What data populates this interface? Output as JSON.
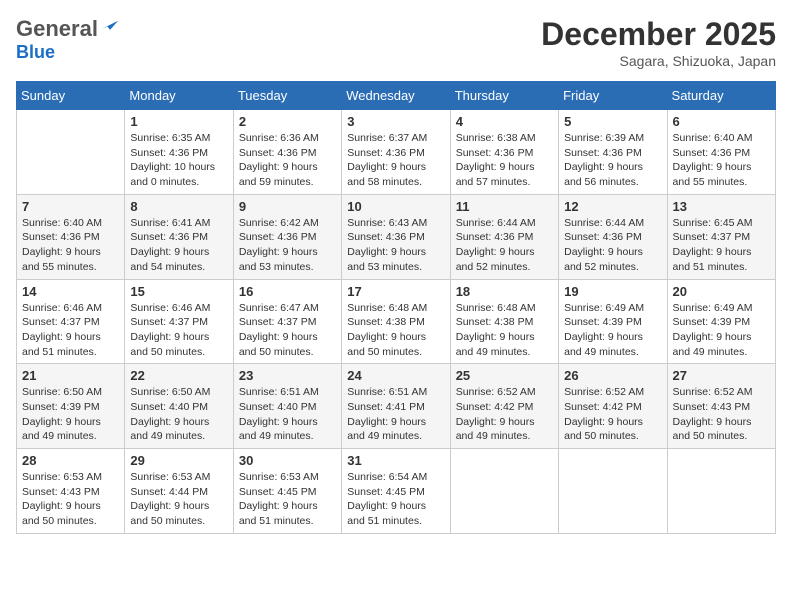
{
  "logo": {
    "general": "General",
    "blue": "Blue"
  },
  "header": {
    "month": "December 2025",
    "location": "Sagara, Shizuoka, Japan"
  },
  "weekdays": [
    "Sunday",
    "Monday",
    "Tuesday",
    "Wednesday",
    "Thursday",
    "Friday",
    "Saturday"
  ],
  "weeks": [
    [
      {
        "day": "",
        "sunrise": "",
        "sunset": "",
        "daylight": ""
      },
      {
        "day": "1",
        "sunrise": "Sunrise: 6:35 AM",
        "sunset": "Sunset: 4:36 PM",
        "daylight": "Daylight: 10 hours and 0 minutes."
      },
      {
        "day": "2",
        "sunrise": "Sunrise: 6:36 AM",
        "sunset": "Sunset: 4:36 PM",
        "daylight": "Daylight: 9 hours and 59 minutes."
      },
      {
        "day": "3",
        "sunrise": "Sunrise: 6:37 AM",
        "sunset": "Sunset: 4:36 PM",
        "daylight": "Daylight: 9 hours and 58 minutes."
      },
      {
        "day": "4",
        "sunrise": "Sunrise: 6:38 AM",
        "sunset": "Sunset: 4:36 PM",
        "daylight": "Daylight: 9 hours and 57 minutes."
      },
      {
        "day": "5",
        "sunrise": "Sunrise: 6:39 AM",
        "sunset": "Sunset: 4:36 PM",
        "daylight": "Daylight: 9 hours and 56 minutes."
      },
      {
        "day": "6",
        "sunrise": "Sunrise: 6:40 AM",
        "sunset": "Sunset: 4:36 PM",
        "daylight": "Daylight: 9 hours and 55 minutes."
      }
    ],
    [
      {
        "day": "7",
        "sunrise": "Sunrise: 6:40 AM",
        "sunset": "Sunset: 4:36 PM",
        "daylight": "Daylight: 9 hours and 55 minutes."
      },
      {
        "day": "8",
        "sunrise": "Sunrise: 6:41 AM",
        "sunset": "Sunset: 4:36 PM",
        "daylight": "Daylight: 9 hours and 54 minutes."
      },
      {
        "day": "9",
        "sunrise": "Sunrise: 6:42 AM",
        "sunset": "Sunset: 4:36 PM",
        "daylight": "Daylight: 9 hours and 53 minutes."
      },
      {
        "day": "10",
        "sunrise": "Sunrise: 6:43 AM",
        "sunset": "Sunset: 4:36 PM",
        "daylight": "Daylight: 9 hours and 53 minutes."
      },
      {
        "day": "11",
        "sunrise": "Sunrise: 6:44 AM",
        "sunset": "Sunset: 4:36 PM",
        "daylight": "Daylight: 9 hours and 52 minutes."
      },
      {
        "day": "12",
        "sunrise": "Sunrise: 6:44 AM",
        "sunset": "Sunset: 4:36 PM",
        "daylight": "Daylight: 9 hours and 52 minutes."
      },
      {
        "day": "13",
        "sunrise": "Sunrise: 6:45 AM",
        "sunset": "Sunset: 4:37 PM",
        "daylight": "Daylight: 9 hours and 51 minutes."
      }
    ],
    [
      {
        "day": "14",
        "sunrise": "Sunrise: 6:46 AM",
        "sunset": "Sunset: 4:37 PM",
        "daylight": "Daylight: 9 hours and 51 minutes."
      },
      {
        "day": "15",
        "sunrise": "Sunrise: 6:46 AM",
        "sunset": "Sunset: 4:37 PM",
        "daylight": "Daylight: 9 hours and 50 minutes."
      },
      {
        "day": "16",
        "sunrise": "Sunrise: 6:47 AM",
        "sunset": "Sunset: 4:37 PM",
        "daylight": "Daylight: 9 hours and 50 minutes."
      },
      {
        "day": "17",
        "sunrise": "Sunrise: 6:48 AM",
        "sunset": "Sunset: 4:38 PM",
        "daylight": "Daylight: 9 hours and 50 minutes."
      },
      {
        "day": "18",
        "sunrise": "Sunrise: 6:48 AM",
        "sunset": "Sunset: 4:38 PM",
        "daylight": "Daylight: 9 hours and 49 minutes."
      },
      {
        "day": "19",
        "sunrise": "Sunrise: 6:49 AM",
        "sunset": "Sunset: 4:39 PM",
        "daylight": "Daylight: 9 hours and 49 minutes."
      },
      {
        "day": "20",
        "sunrise": "Sunrise: 6:49 AM",
        "sunset": "Sunset: 4:39 PM",
        "daylight": "Daylight: 9 hours and 49 minutes."
      }
    ],
    [
      {
        "day": "21",
        "sunrise": "Sunrise: 6:50 AM",
        "sunset": "Sunset: 4:39 PM",
        "daylight": "Daylight: 9 hours and 49 minutes."
      },
      {
        "day": "22",
        "sunrise": "Sunrise: 6:50 AM",
        "sunset": "Sunset: 4:40 PM",
        "daylight": "Daylight: 9 hours and 49 minutes."
      },
      {
        "day": "23",
        "sunrise": "Sunrise: 6:51 AM",
        "sunset": "Sunset: 4:40 PM",
        "daylight": "Daylight: 9 hours and 49 minutes."
      },
      {
        "day": "24",
        "sunrise": "Sunrise: 6:51 AM",
        "sunset": "Sunset: 4:41 PM",
        "daylight": "Daylight: 9 hours and 49 minutes."
      },
      {
        "day": "25",
        "sunrise": "Sunrise: 6:52 AM",
        "sunset": "Sunset: 4:42 PM",
        "daylight": "Daylight: 9 hours and 49 minutes."
      },
      {
        "day": "26",
        "sunrise": "Sunrise: 6:52 AM",
        "sunset": "Sunset: 4:42 PM",
        "daylight": "Daylight: 9 hours and 50 minutes."
      },
      {
        "day": "27",
        "sunrise": "Sunrise: 6:52 AM",
        "sunset": "Sunset: 4:43 PM",
        "daylight": "Daylight: 9 hours and 50 minutes."
      }
    ],
    [
      {
        "day": "28",
        "sunrise": "Sunrise: 6:53 AM",
        "sunset": "Sunset: 4:43 PM",
        "daylight": "Daylight: 9 hours and 50 minutes."
      },
      {
        "day": "29",
        "sunrise": "Sunrise: 6:53 AM",
        "sunset": "Sunset: 4:44 PM",
        "daylight": "Daylight: 9 hours and 50 minutes."
      },
      {
        "day": "30",
        "sunrise": "Sunrise: 6:53 AM",
        "sunset": "Sunset: 4:45 PM",
        "daylight": "Daylight: 9 hours and 51 minutes."
      },
      {
        "day": "31",
        "sunrise": "Sunrise: 6:54 AM",
        "sunset": "Sunset: 4:45 PM",
        "daylight": "Daylight: 9 hours and 51 minutes."
      },
      {
        "day": "",
        "sunrise": "",
        "sunset": "",
        "daylight": ""
      },
      {
        "day": "",
        "sunrise": "",
        "sunset": "",
        "daylight": ""
      },
      {
        "day": "",
        "sunrise": "",
        "sunset": "",
        "daylight": ""
      }
    ]
  ]
}
